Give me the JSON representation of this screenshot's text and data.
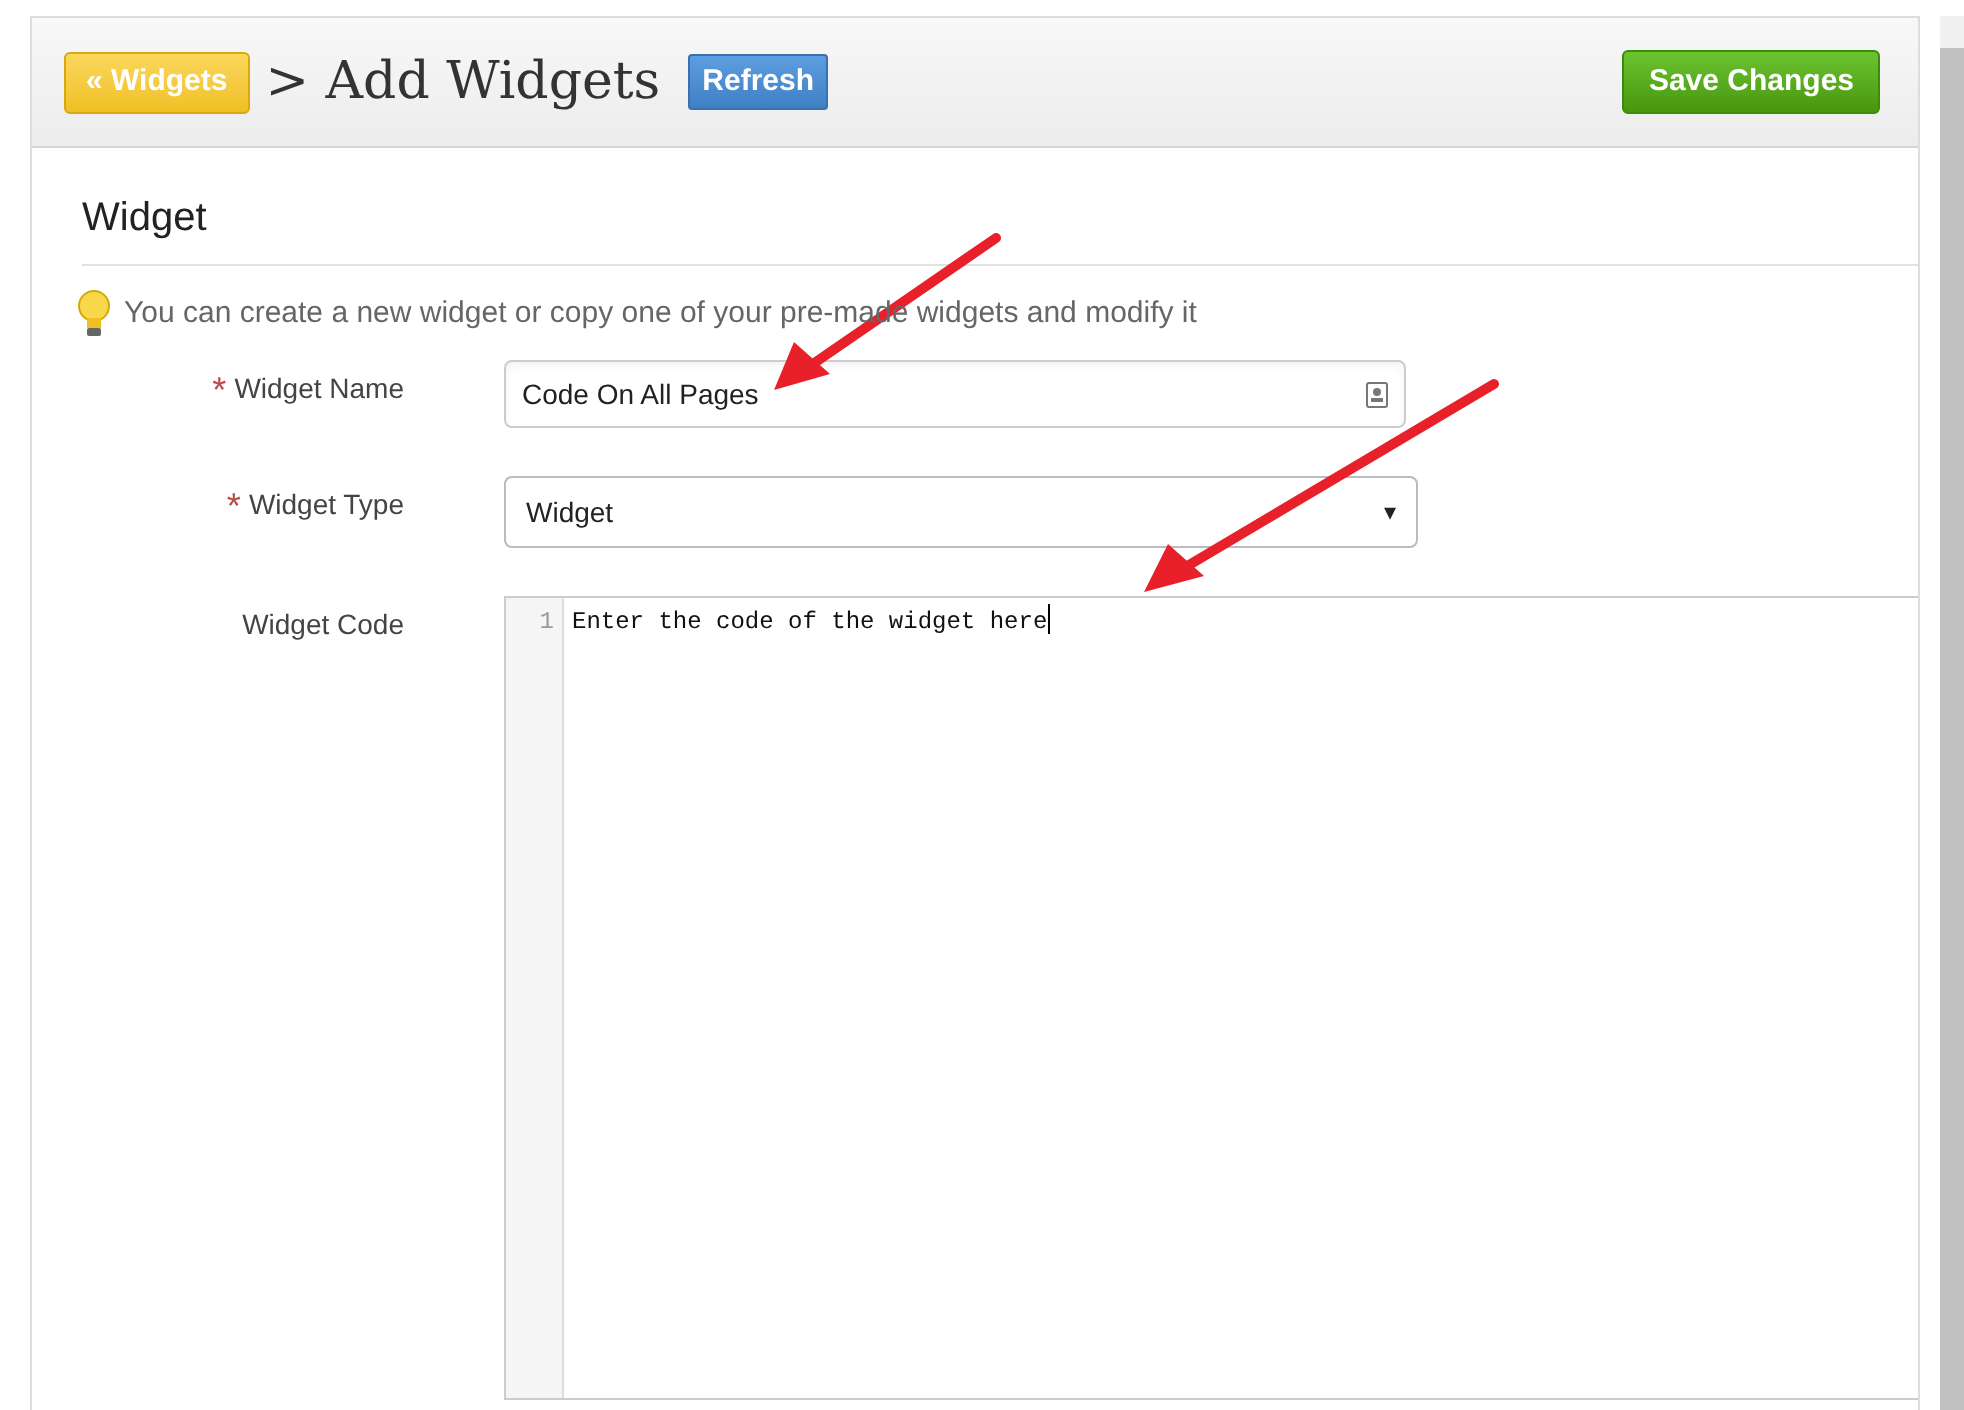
{
  "header": {
    "back_button": "« Widgets",
    "title": "> Add Widgets",
    "refresh_button": "Refresh",
    "save_button": "Save Changes"
  },
  "section": {
    "title": "Widget",
    "hint": "You can create a new widget or copy one of your pre-made widgets and modify it"
  },
  "fields": [
    {
      "kind": "text",
      "label": "Widget Name",
      "required": true,
      "value": "Code On All Pages"
    },
    {
      "kind": "select",
      "label": "Widget Type",
      "required": true,
      "value": "Widget",
      "caret": "▾"
    },
    {
      "kind": "code",
      "label": "Widget Code",
      "required": false,
      "line_number": "1",
      "value": "Enter the code of the widget here"
    }
  ],
  "required_mark": "*"
}
